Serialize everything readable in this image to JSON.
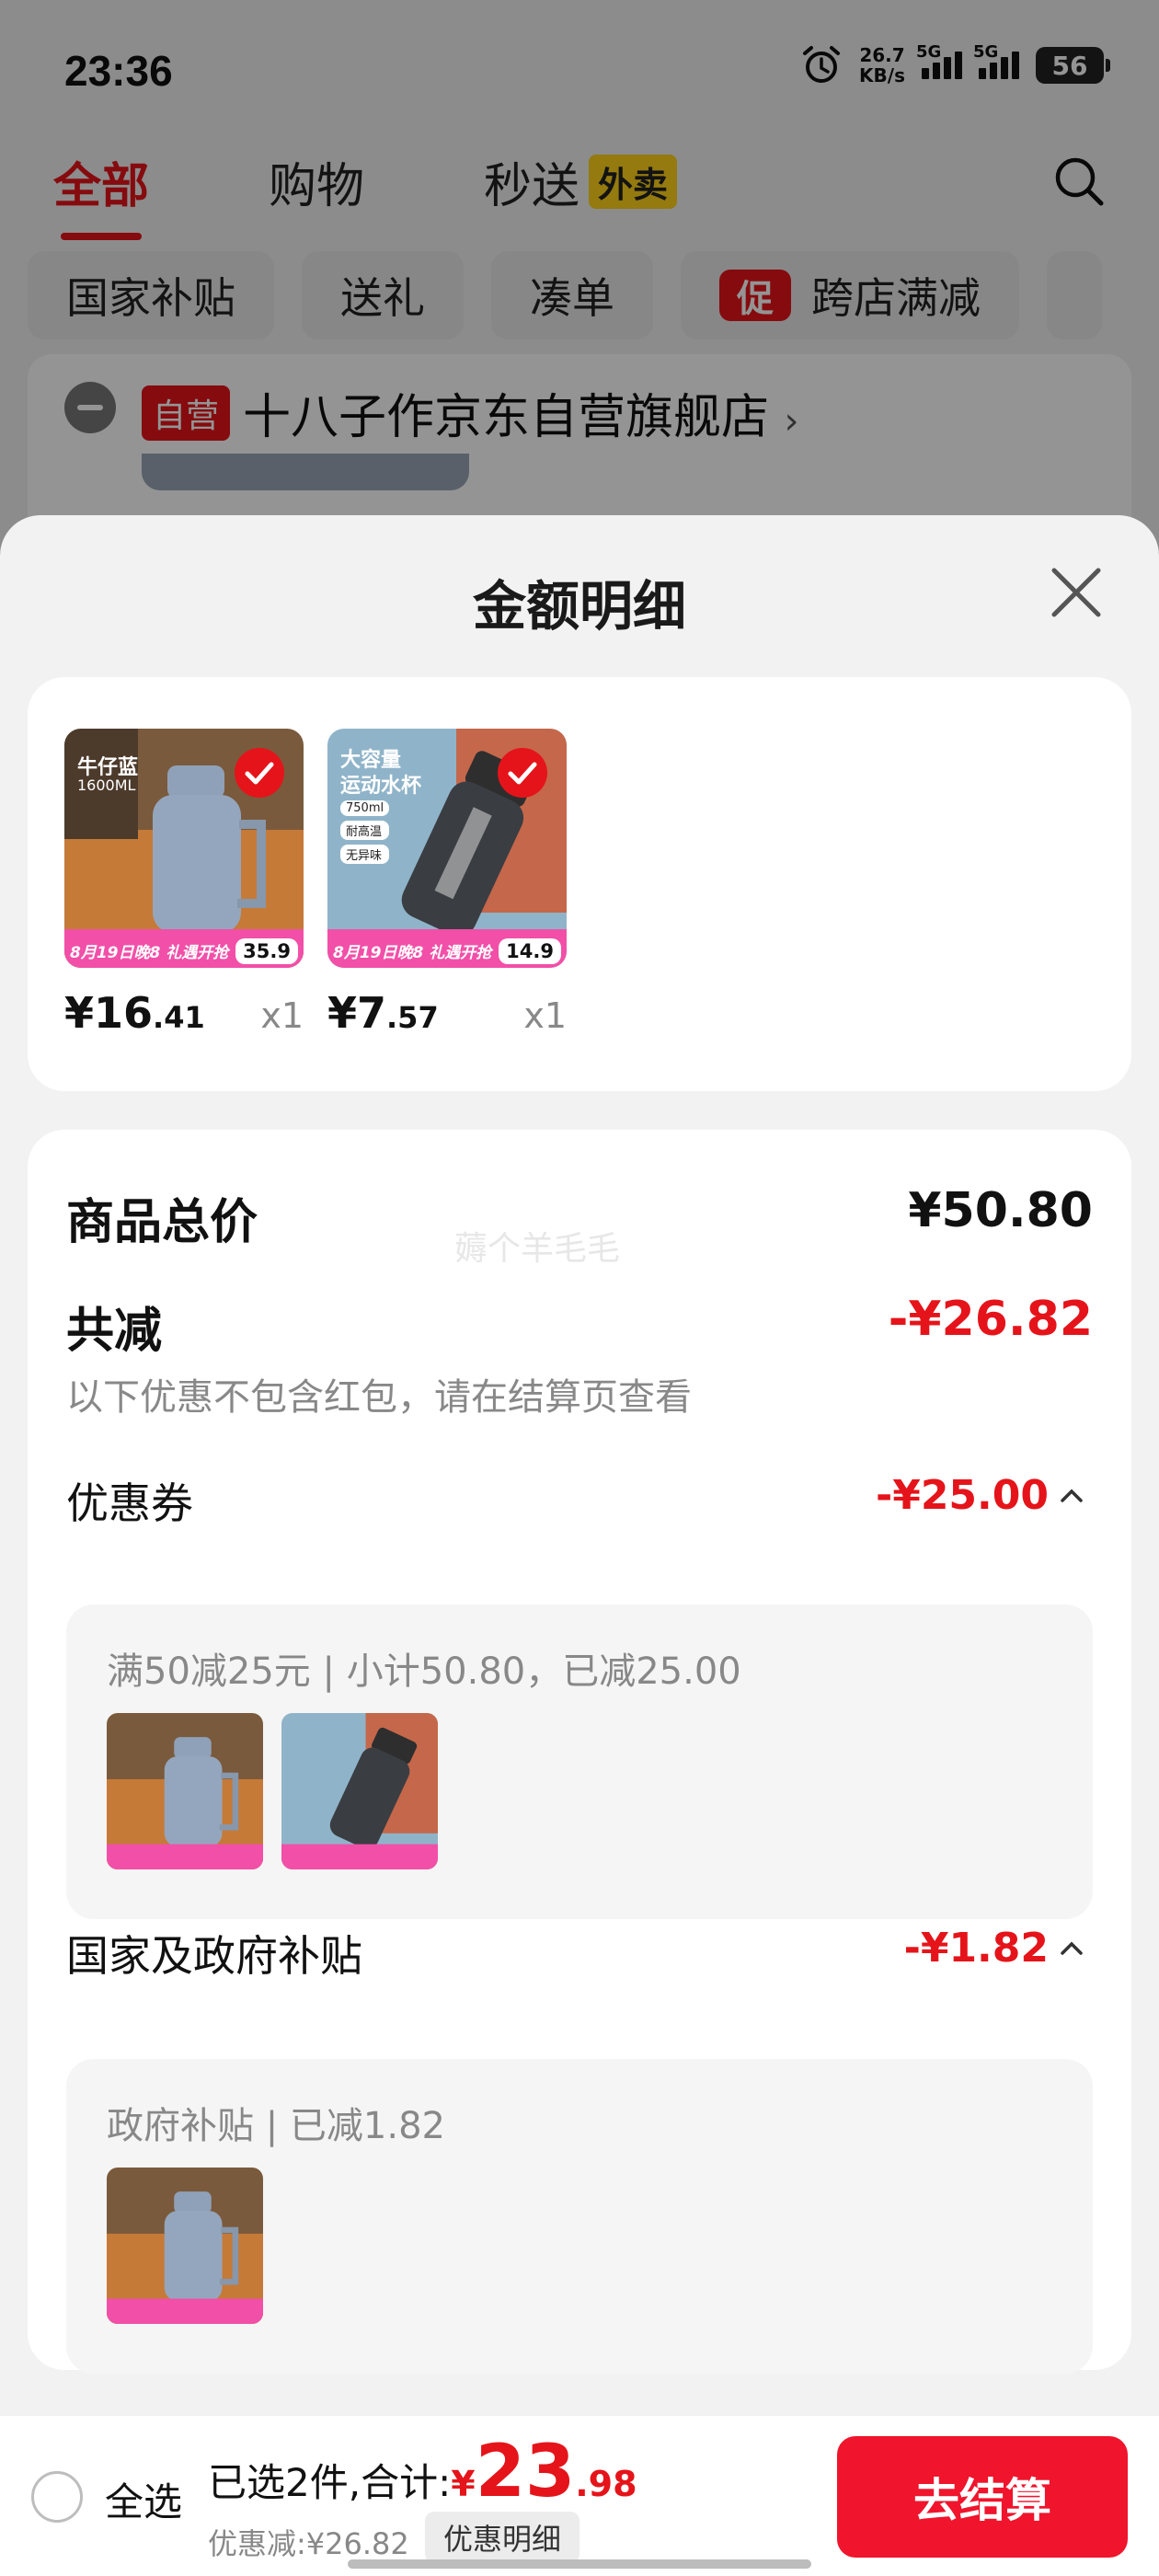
{
  "status_bar": {
    "time": "23:36",
    "net_speed_value": "26.7",
    "net_speed_unit": "KB/s",
    "signal1": "5G",
    "signal2": "5G",
    "battery": "56"
  },
  "top_tabs": [
    {
      "label": "全部",
      "active": true
    },
    {
      "label": "购物",
      "active": false
    },
    {
      "label": "秒送",
      "active": false
    }
  ],
  "takeaway_badge": "外卖",
  "filters": [
    "国家补贴",
    "送礼",
    "凑单",
    "跨店满减"
  ],
  "promo_tag": "促",
  "store": {
    "badge": "自营",
    "name": "十八子作京东自营旗舰店",
    "arrow": "›"
  },
  "sheet": {
    "title": "金额明细",
    "items": [
      {
        "img_title": "牛仔蓝",
        "img_sub": "1600ML",
        "img_banner": "8月19日晚8 礼遇开抢",
        "img_price": "35.9",
        "price_int": "¥16",
        "price_dec": ".41",
        "qty": "x1"
      },
      {
        "img_title": "大容量",
        "img_title2": "运动水杯",
        "img_tags": [
          "750ml",
          "耐高温",
          "无异味"
        ],
        "img_banner": "8月19日晚8 礼遇开抢",
        "img_price": "14.9",
        "price_int": "¥7",
        "price_dec": ".57",
        "qty": "x1"
      }
    ],
    "total_label": "商品总价",
    "total_value": "¥50.80",
    "watermark": "薅个羊毛毛",
    "reduce_label": "共减",
    "reduce_value": "-¥26.82",
    "reduce_note": "以下优惠不包含红包，请在结算页查看",
    "coupon": {
      "label": "优惠券",
      "value": "-¥25.00",
      "detail": "满50减25元 | 小计50.80，已减25.00"
    },
    "subsidy": {
      "label": "国家及政府补贴",
      "value": "-¥1.82",
      "detail": "政府补贴 | 已减1.82"
    }
  },
  "bottom_bar": {
    "select_all": "全选",
    "summary_prefix": "已选2件,合计:",
    "total_symbol": "¥",
    "total_int": "23",
    "total_dec": ".98",
    "discount": "优惠减:¥26.82",
    "detail_button": "优惠明细",
    "checkout": "去结算"
  },
  "colors": {
    "accent_red": "#e5141a",
    "takeaway_yellow": "#ffd21a",
    "checkout_red": "#f0142c"
  }
}
